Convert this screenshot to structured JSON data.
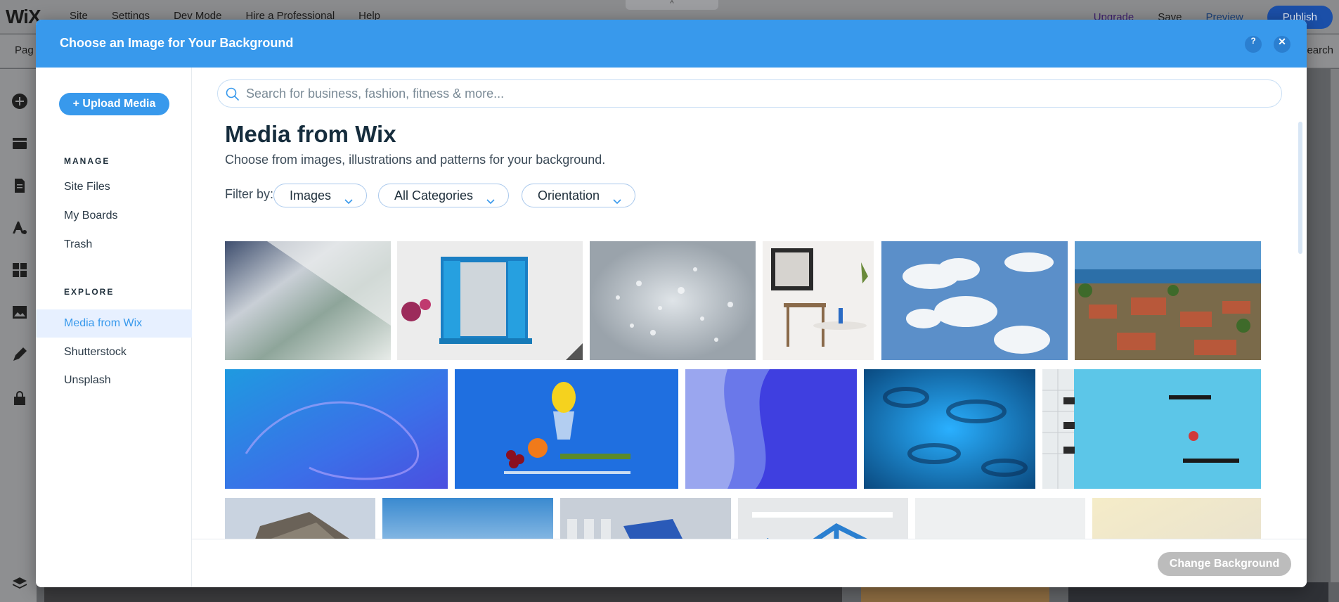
{
  "editor": {
    "logo": "WiX",
    "menu": [
      "Site",
      "Settings",
      "Dev Mode",
      "Hire a Professional",
      "Help"
    ],
    "upgrade": "Upgrade",
    "save": "Save",
    "preview": "Preview",
    "publish": "Publish",
    "subbar_left": "Pag",
    "subbar_right": "earch",
    "handle": "^"
  },
  "modal": {
    "title": "Choose an Image for Your Background",
    "help": "?",
    "close": "✕"
  },
  "sidebar": {
    "upload": "+ Upload Media",
    "manage_title": "MANAGE",
    "manage_items": [
      "Site Files",
      "My Boards",
      "Trash"
    ],
    "explore_title": "EXPLORE",
    "explore_items": [
      "Media from Wix",
      "Shutterstock",
      "Unsplash"
    ],
    "active_item": "Media from Wix"
  },
  "search": {
    "placeholder": "Search for business, fashion, fitness & more...",
    "value": ""
  },
  "main": {
    "title": "Media from Wix",
    "subtitle": "Choose from images, illustrations and patterns for your background.",
    "filter_label": "Filter by:",
    "filters": [
      "Images",
      "All Categories",
      "Orientation"
    ]
  },
  "footer": {
    "change_button": "Change Background"
  },
  "colors": {
    "accent": "#3899ec",
    "active_bg": "#e7f0ff",
    "disabled_button": "#bcbcbc"
  },
  "icons": {
    "search": "search-icon",
    "chevron": "chevron-down-icon",
    "help": "help-icon",
    "close": "close-icon"
  }
}
